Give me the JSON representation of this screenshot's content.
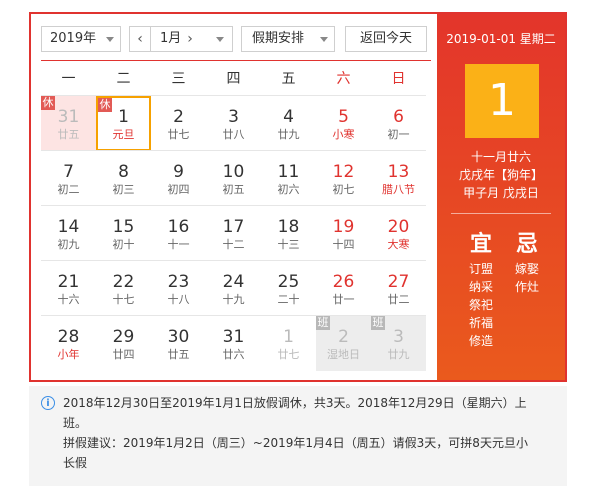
{
  "toolbar": {
    "year": "2019年",
    "prev_arrow": "‹",
    "month": "1月",
    "next_arrow": "›",
    "holiday": "假期安排",
    "today": "返回今天"
  },
  "weekdays": [
    "一",
    "二",
    "三",
    "四",
    "五",
    "六",
    "日"
  ],
  "rows": [
    [
      {
        "n": "31",
        "l": "廿五",
        "other": true,
        "badge": "休",
        "badgeType": "rest",
        "bg": "rest"
      },
      {
        "n": "1",
        "l": "元旦",
        "badge": "休",
        "badgeType": "rest",
        "selected": true,
        "lred": true
      },
      {
        "n": "2",
        "l": "廿七"
      },
      {
        "n": "3",
        "l": "廿八"
      },
      {
        "n": "4",
        "l": "廿九"
      },
      {
        "n": "5",
        "l": "小寒",
        "we": true,
        "lred": true
      },
      {
        "n": "6",
        "l": "初一",
        "we": true
      }
    ],
    [
      {
        "n": "7",
        "l": "初二"
      },
      {
        "n": "8",
        "l": "初三"
      },
      {
        "n": "9",
        "l": "初四"
      },
      {
        "n": "10",
        "l": "初五"
      },
      {
        "n": "11",
        "l": "初六"
      },
      {
        "n": "12",
        "l": "初七",
        "we": true
      },
      {
        "n": "13",
        "l": "腊八节",
        "we": true,
        "lred": true
      }
    ],
    [
      {
        "n": "14",
        "l": "初九"
      },
      {
        "n": "15",
        "l": "初十"
      },
      {
        "n": "16",
        "l": "十一"
      },
      {
        "n": "17",
        "l": "十二"
      },
      {
        "n": "18",
        "l": "十三"
      },
      {
        "n": "19",
        "l": "十四",
        "we": true
      },
      {
        "n": "20",
        "l": "大寒",
        "we": true,
        "lred": true
      }
    ],
    [
      {
        "n": "21",
        "l": "十六"
      },
      {
        "n": "22",
        "l": "十七"
      },
      {
        "n": "23",
        "l": "十八"
      },
      {
        "n": "24",
        "l": "十九"
      },
      {
        "n": "25",
        "l": "二十"
      },
      {
        "n": "26",
        "l": "廿一",
        "we": true
      },
      {
        "n": "27",
        "l": "廿二",
        "we": true
      }
    ],
    [
      {
        "n": "28",
        "l": "小年",
        "lred": true
      },
      {
        "n": "29",
        "l": "廿四"
      },
      {
        "n": "30",
        "l": "廿五"
      },
      {
        "n": "31",
        "l": "廿六"
      },
      {
        "n": "1",
        "l": "廿七",
        "other": true
      },
      {
        "n": "2",
        "l": "湿地日",
        "other": true,
        "badge": "班",
        "badgeType": "work",
        "bg": "work"
      },
      {
        "n": "3",
        "l": "廿九",
        "other": true,
        "badge": "班",
        "badgeType": "work",
        "bg": "work"
      }
    ]
  ],
  "panel": {
    "date_line": "2019-01-01 星期二",
    "day": "1",
    "lunar": "十一月廿六",
    "ganzhi_year": "戊戌年【狗年】",
    "ganzhi_month_day": "甲子月 戊戌日",
    "yi_title": "宜",
    "ji_title": "忌",
    "yi_items": [
      "订盟",
      "纳采",
      "祭祀",
      "祈福",
      "修造"
    ],
    "ji_items": [
      "嫁娶",
      "作灶"
    ]
  },
  "notice": {
    "icon": "i",
    "line1": "2018年12月30日至2019年1月1日放假调休，共3天。2018年12月29日（星期六）上",
    "line2": "班。",
    "line3": "拼假建议：2019年1月2日（周三）~2019年1月4日（周五）请假3天，可拼8天元旦小",
    "line4": "长假"
  },
  "colors": {
    "accent_red": "#e0332f",
    "panel_gold": "#fbb117",
    "selected_border": "#f6a100",
    "info_blue": "#3a8ee6"
  }
}
